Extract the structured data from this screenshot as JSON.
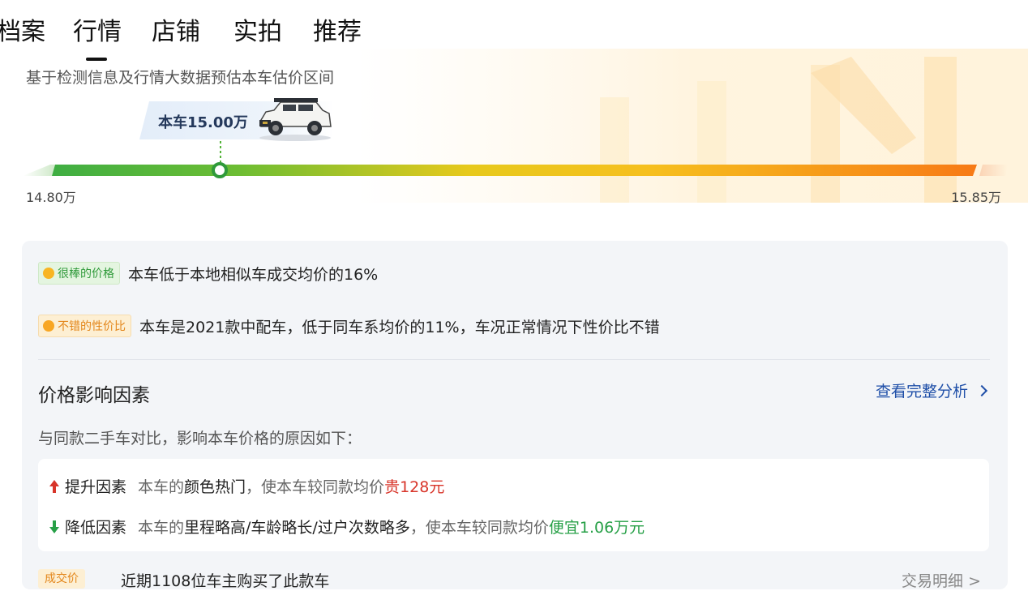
{
  "tabs": [
    {
      "label": "档案",
      "active": false
    },
    {
      "label": "行情",
      "active": true
    },
    {
      "label": "店铺",
      "active": false
    },
    {
      "label": "实拍",
      "active": false
    },
    {
      "label": "推荐",
      "active": false
    }
  ],
  "estimate": {
    "subtitle": "基于检测信息及行情大数据预估本车估价区间",
    "current_price_label": "本车15.00万",
    "min_label": "14.80万",
    "max_label": "15.85万",
    "min_value": 14.8,
    "max_value": 15.85,
    "current_value": 15.0
  },
  "evaluations": [
    {
      "badge": "很棒的价格",
      "badge_color": "#2f9a3a",
      "icon": "smile-emoji-icon",
      "text": "本车低于本地相似车成交均价的16%"
    },
    {
      "badge": "不错的性价比",
      "badge_color": "#e3861a",
      "icon": "smile-emoji-icon",
      "text": "本车是2021款中配车，低于同车系均价的11%，车况正常情况下性价比不错"
    }
  ],
  "factors": {
    "title": "价格影响因素",
    "link": "查看完整分析",
    "description": "与同款二手车对比，影响本车价格的原因如下：",
    "up": {
      "label": "提升因素",
      "prefix": "本车的",
      "key": "颜色热门",
      "middle": "，使本车较同款均价",
      "result": "贵128元",
      "icon": "arrow-up-icon",
      "color": "#d8352a"
    },
    "down": {
      "label": "降低因素",
      "prefix": "本车的",
      "key": "里程略高/车龄略长/过户次数略多",
      "middle": "，使本车较同款均价",
      "result": "便宜1.06万元",
      "icon": "arrow-down-icon",
      "color": "#27a047"
    }
  },
  "next": {
    "badge": "成交价",
    "text": "近期1108位车主购买了此款车",
    "link": "交易明细 >"
  }
}
